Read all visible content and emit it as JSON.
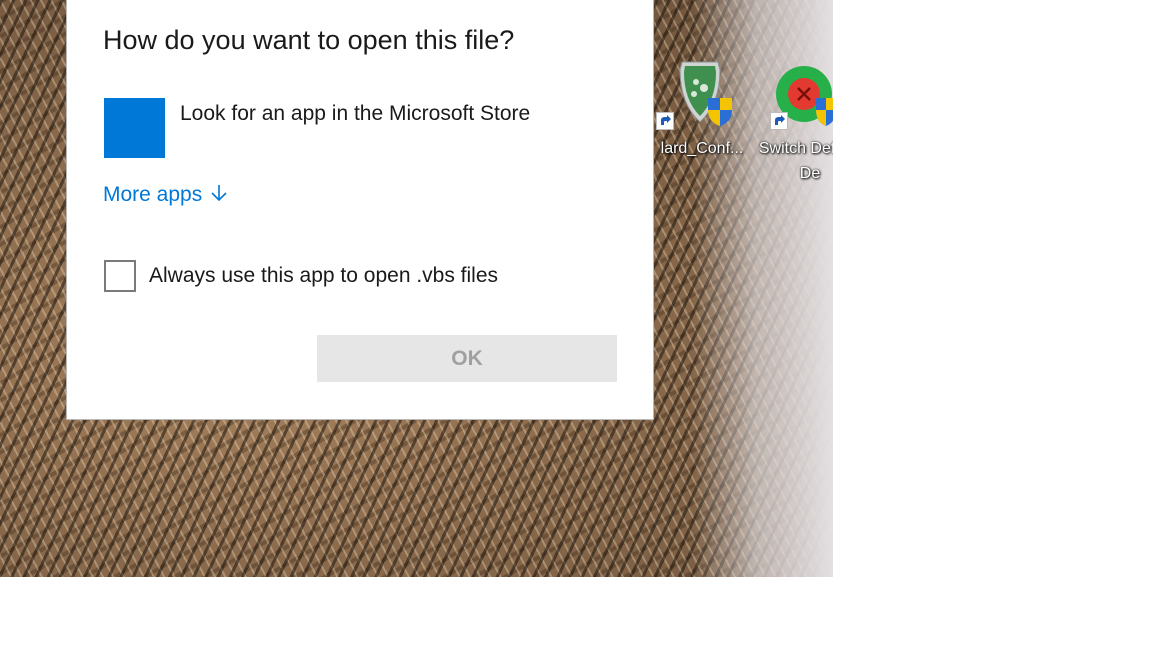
{
  "dialog": {
    "title": "How do you want to open this file?",
    "store_option_label": "Look for an app in the Microsoft Store",
    "store_tile_color": "#0078d7",
    "more_apps_label": "More apps",
    "more_apps_icon": "arrow-down-icon",
    "always_use_label": "Always use this app to open .vbs files",
    "always_use_checked": false,
    "ok_label": "OK",
    "ok_enabled": false
  },
  "desktop": {
    "icons": [
      {
        "label": "lard_Conf...",
        "icon": "shield-config-icon"
      },
      {
        "label": "Switch Default De",
        "icon": "switch-default-icon"
      }
    ]
  },
  "colors": {
    "accent": "#0078d7",
    "uac_shield_blue": "#2a6fd6",
    "uac_shield_yellow": "#f5c400"
  }
}
